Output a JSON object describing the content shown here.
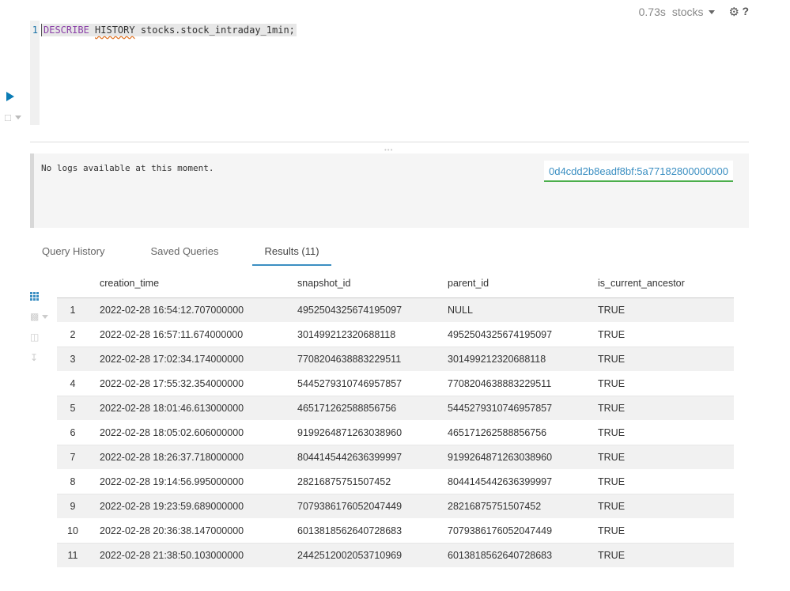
{
  "status": {
    "time": "0.73s",
    "database": "stocks",
    "help": "?"
  },
  "editor": {
    "line_number": "1",
    "keyword1": "DESCRIBE",
    "keyword2": "HISTORY",
    "rest": " stocks.stock_intraday_1min;"
  },
  "logs": {
    "message": "No logs available at this moment.",
    "query_id": "0d4cdd2b8eadf8bf:5a77182800000000"
  },
  "tabs": [
    {
      "label": "Query History"
    },
    {
      "label": "Saved Queries"
    },
    {
      "label": "Results (11)"
    }
  ],
  "table": {
    "columns": [
      "creation_time",
      "snapshot_id",
      "parent_id",
      "is_current_ancestor"
    ],
    "rows": [
      [
        "1",
        "2022-02-28 16:54:12.707000000",
        "4952504325674195097",
        "NULL",
        "TRUE"
      ],
      [
        "2",
        "2022-02-28 16:57:11.674000000",
        "301499212320688118",
        "4952504325674195097",
        "TRUE"
      ],
      [
        "3",
        "2022-02-28 17:02:34.174000000",
        "7708204638883229511",
        "301499212320688118",
        "TRUE"
      ],
      [
        "4",
        "2022-02-28 17:55:32.354000000",
        "5445279310746957857",
        "7708204638883229511",
        "TRUE"
      ],
      [
        "5",
        "2022-02-28 18:01:46.613000000",
        "465171262588856756",
        "5445279310746957857",
        "TRUE"
      ],
      [
        "6",
        "2022-02-28 18:05:02.606000000",
        "9199264871263038960",
        "465171262588856756",
        "TRUE"
      ],
      [
        "7",
        "2022-02-28 18:26:37.718000000",
        "8044145442636399997",
        "9199264871263038960",
        "TRUE"
      ],
      [
        "8",
        "2022-02-28 19:14:56.995000000",
        "28216875751507452",
        "8044145442636399997",
        "TRUE"
      ],
      [
        "9",
        "2022-02-28 19:23:59.689000000",
        "7079386176052047449",
        "28216875751507452",
        "TRUE"
      ],
      [
        "10",
        "2022-02-28 20:36:38.147000000",
        "6013818562640728683",
        "7079386176052047449",
        "TRUE"
      ],
      [
        "11",
        "2022-02-28 21:38:50.103000000",
        "2442512002053710969",
        "6013818562640728683",
        "TRUE"
      ]
    ]
  },
  "icons": {
    "run": "play-icon",
    "map": "map-icon",
    "settings": "gear-icon",
    "grid": "grid-icon",
    "chart": "bar-chart-icon",
    "columns": "columns-icon",
    "download": "download-icon"
  }
}
